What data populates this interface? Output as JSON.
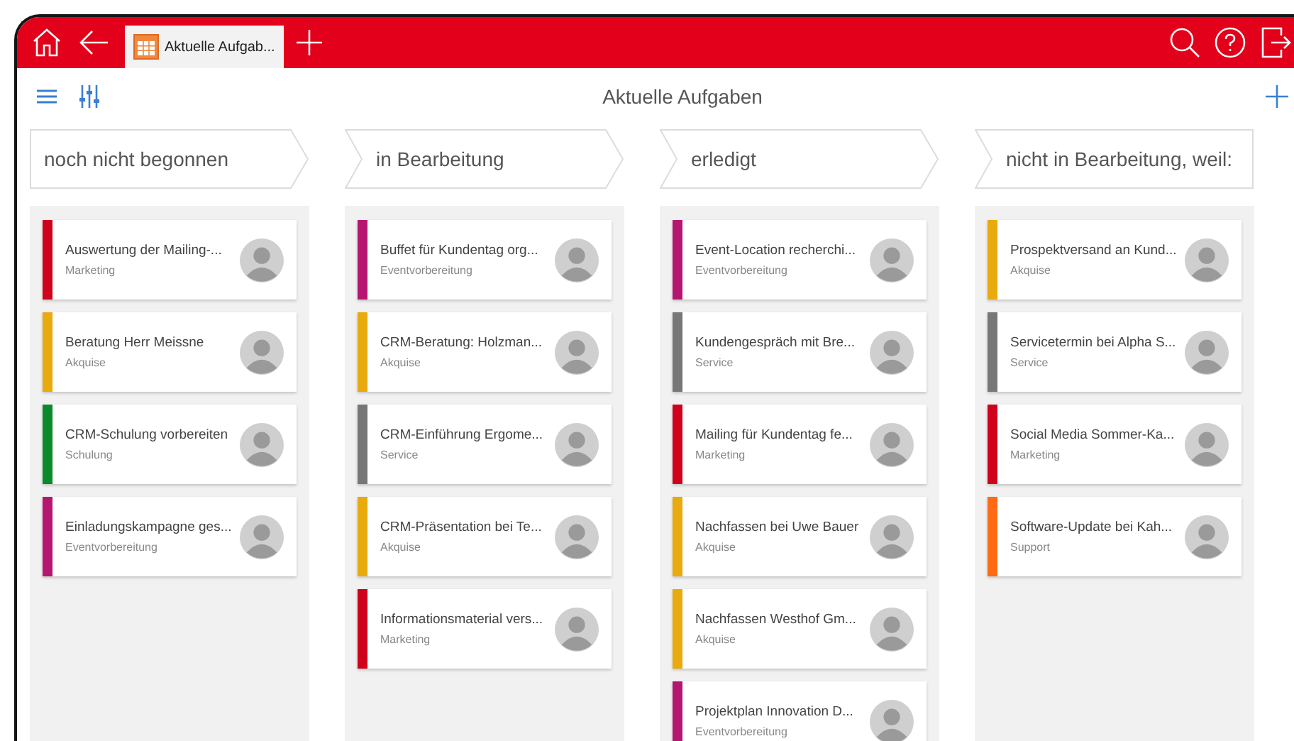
{
  "tabs": [
    {
      "label": "Aktuelle Aufgab...",
      "selected": true
    }
  ],
  "page_title": "Aktuelle Aufgaben",
  "columns": [
    {
      "title": "noch nicht begonnen",
      "cards": [
        {
          "title": "Auswertung der Mailing-...",
          "category": "Marketing",
          "color": "#d0021b"
        },
        {
          "title": "Beratung Herr Meissne",
          "category": "Akquise",
          "color": "#e8aa0c"
        },
        {
          "title": "CRM-Schulung vorbereiten",
          "category": "Schulung",
          "color": "#0a8a2a"
        },
        {
          "title": "Einladungskampagne ges...",
          "category": "Eventvorbereitung",
          "color": "#b5166f"
        }
      ]
    },
    {
      "title": "in Bearbeitung",
      "cards": [
        {
          "title": "Buffet für Kundentag org...",
          "category": "Eventvorbereitung",
          "color": "#b5166f"
        },
        {
          "title": "CRM-Beratung: Holzman...",
          "category": "Akquise",
          "color": "#e8aa0c"
        },
        {
          "title": "CRM-Einführung Ergome...",
          "category": "Service",
          "color": "#777777"
        },
        {
          "title": "CRM-Präsentation bei Te...",
          "category": "Akquise",
          "color": "#e8aa0c"
        },
        {
          "title": "Informationsmaterial vers...",
          "category": "Marketing",
          "color": "#d0021b"
        }
      ]
    },
    {
      "title": "erledigt",
      "cards": [
        {
          "title": "Event-Location recherchi...",
          "category": "Eventvorbereitung",
          "color": "#b5166f"
        },
        {
          "title": "Kundengespräch mit Bre...",
          "category": "Service",
          "color": "#777777"
        },
        {
          "title": "Mailing für Kundentag fe...",
          "category": "Marketing",
          "color": "#d0021b"
        },
        {
          "title": "Nachfassen bei Uwe Bauer",
          "category": "Akquise",
          "color": "#e8aa0c"
        },
        {
          "title": "Nachfassen Westhof Gm...",
          "category": "Akquise",
          "color": "#e8aa0c"
        },
        {
          "title": "Projektplan Innovation D...",
          "category": "Eventvorbereitung",
          "color": "#b5166f"
        }
      ]
    },
    {
      "title": "nicht in Bearbeitung, weil:",
      "cards": [
        {
          "title": "Prospektversand an Kund...",
          "category": "Akquise",
          "color": "#e8aa0c"
        },
        {
          "title": "Servicetermin bei Alpha S...",
          "category": "Service",
          "color": "#777777"
        },
        {
          "title": "Social Media Sommer-Ka...",
          "category": "Marketing",
          "color": "#d0021b"
        },
        {
          "title": "Software-Update bei Kah...",
          "category": "Support",
          "color": "#ff6a13"
        }
      ]
    }
  ]
}
